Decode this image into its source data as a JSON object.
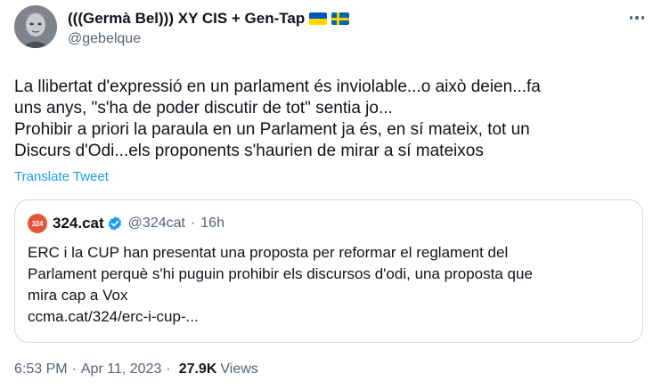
{
  "author": {
    "display_name": "(((Germà Bel))) XY CIS + Gen-Tap",
    "handle": "@gebelque",
    "flags": [
      "ukraine-flag",
      "sweden-flag"
    ]
  },
  "tweet": {
    "text": "La llibertat d'expressió en un parlament és inviolable...o això deien...fa\nuns anys, \"s'ha de poder discutir de tot\" sentia jo...\nProhibir a priori la paraula en un Parlament ja és, en sí mateix, tot un\nDiscurs d'Odi...els proponents s'haurien de mirar a sí mateixos",
    "translate_label": "Translate Tweet"
  },
  "quote": {
    "avatar_text": "324",
    "name": "324.cat",
    "handle": "@324cat",
    "separator": "·",
    "time": "16h",
    "text": "ERC i la CUP han presentat una proposta per reformar el reglament del\nParlament perquè s'hi puguin prohibir els discursos d'odi, una proposta que\nmira cap a Vox",
    "url": "ccma.cat/324/erc-i-cup-..."
  },
  "footer": {
    "time": "6:53 PM",
    "date": "Apr 11, 2023",
    "separator": "·",
    "views_count": "27.9K",
    "views_label": "Views"
  },
  "colors": {
    "text": "#0f1419",
    "secondary": "#536471",
    "link": "#1d9bf0",
    "border": "#cfd9de",
    "quote_avatar": "#e5533d"
  }
}
